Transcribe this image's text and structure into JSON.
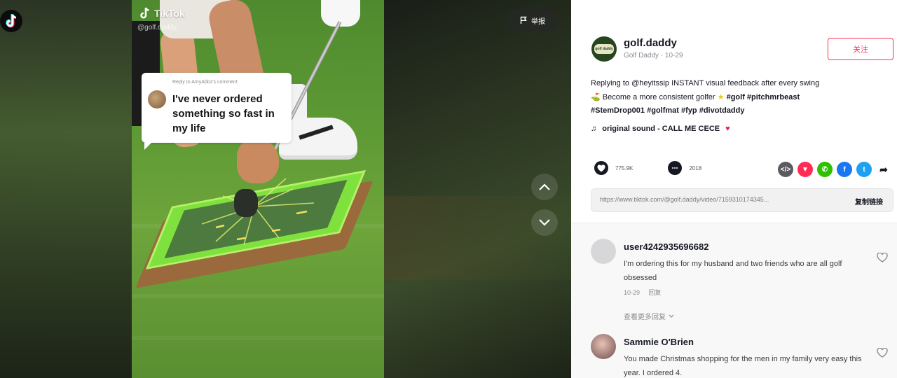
{
  "video": {
    "watermark_text": "TikTok",
    "watermark_handle": "@golf.daddy",
    "reply_label": "Reply to AmyAbbz's comment",
    "reply_text": "I've never ordered something so fast in my life",
    "report_label": "举报"
  },
  "author": {
    "username": "golf.daddy",
    "nickname": "Golf Daddy",
    "date": "10-29",
    "avatar_text": "golf daddy"
  },
  "follow_button": "关注",
  "caption": {
    "text_start": "Replying to @heyitssip INSTANT visual feedback after every swing",
    "text_middle": "Become a more consistent golfer",
    "hashtags_line1": [
      "#golf",
      "#pitchmrbeast"
    ],
    "hashtags_line2": [
      "#StemDrop001",
      "#golfmat",
      "#fyp",
      "#divotdaddy"
    ]
  },
  "music": "original sound - CALL ME CECE",
  "stats": {
    "likes": "775.9K",
    "comments": "2018"
  },
  "link": {
    "url": "https://www.tiktok.com/@golf.daddy/video/7159310174345...",
    "copy_label": "复制链接"
  },
  "comments": [
    {
      "user": "user4242935696682",
      "text": "I'm ordering this for my husband and two friends who are all golf obsessed",
      "time": "10-29",
      "reply_label": "回复"
    },
    {
      "user": "Sammie O'Brien",
      "text": "You made Christmas shopping for the men in my family very easy this year. I ordered 4."
    }
  ],
  "view_replies": "查看更多回复",
  "colors": {
    "accent": "#fe2c55",
    "share_1": "#5b5b5f",
    "share_2": "#fe2c55",
    "share_3": "#2dc100",
    "share_4": "#1877f2",
    "share_5": "#1da1f2"
  },
  "icons": {
    "like": "heart-icon",
    "comment": "comment-icon",
    "share": "share-arrow-icon"
  }
}
